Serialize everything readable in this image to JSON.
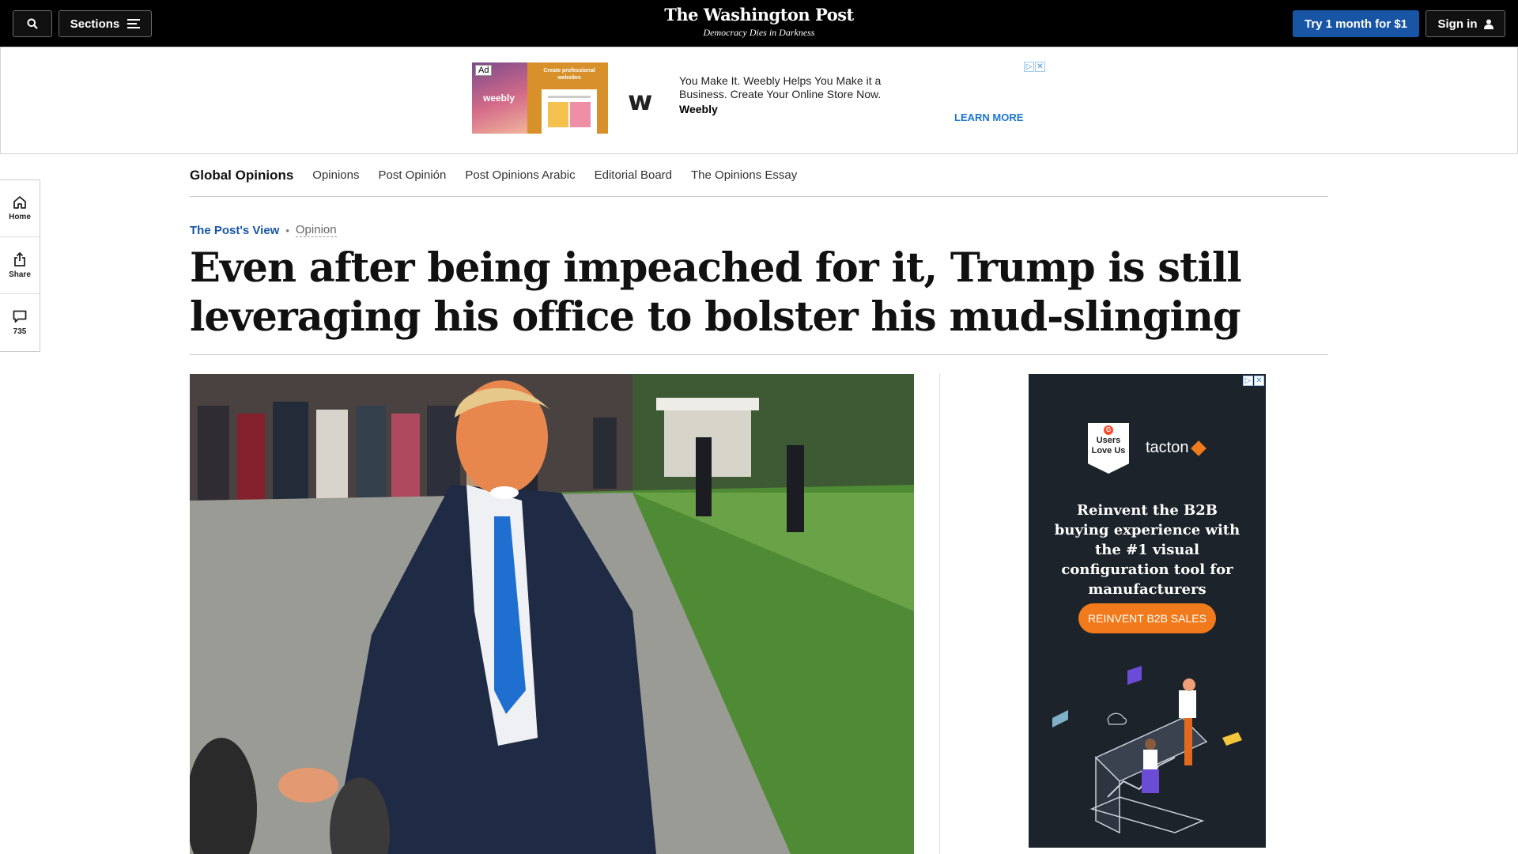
{
  "topbar": {
    "sections_label": "Sections",
    "logo": "The Washington Post",
    "tagline": "Democracy Dies in Darkness",
    "subscribe_label": "Try 1 month for $1",
    "signin_label": "Sign in"
  },
  "ad_banner": {
    "tag": "Ad",
    "thumb_label": "weebly",
    "thumb_heading": "Create professional websites",
    "text": "You Make It. Weebly Helps You Make it a Business. Create Your Online Store Now.",
    "brand": "Weebly",
    "cta": "LEARN MORE"
  },
  "section_nav": {
    "title": "Global Opinions",
    "items": [
      "Opinions",
      "Post Opinión",
      "Post Opinions Arabic",
      "Editorial Board",
      "The Opinions Essay"
    ]
  },
  "side_rail": {
    "home_label": "Home",
    "share_label": "Share",
    "comments_count": "735"
  },
  "article": {
    "kicker": "The Post's View",
    "section": "Opinion",
    "headline": "Even after being impeached for it, Trump is still leveraging his office to bolster his mud-slinging"
  },
  "side_ad": {
    "badge_line1": "Users",
    "badge_line2": "Love Us",
    "brand": "tacton",
    "copy": "Reinvent the B2B buying experience with the #1 visual configuration tool for manufacturers",
    "cta": "REINVENT  B2B SALES"
  },
  "colors": {
    "topbar_bg": "#000000",
    "subscribe_bg": "#1955a5",
    "kicker": "#1955a5",
    "ad_cta": "#f07a1c",
    "side_ad_bg": "#1d232b"
  }
}
